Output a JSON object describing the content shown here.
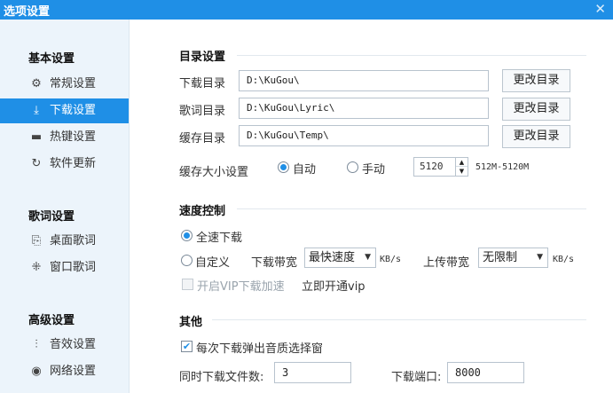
{
  "window": {
    "title": "选项设置",
    "close_glyph": "✕"
  },
  "sidebar": {
    "groups": [
      {
        "label": "基本设置"
      },
      {
        "label": "歌词设置"
      },
      {
        "label": "高级设置"
      }
    ],
    "items": [
      {
        "label": "常规设置",
        "icon": "gear-icon",
        "glyph": "⚙"
      },
      {
        "label": "下载设置",
        "icon": "download-icon",
        "glyph": "⤓",
        "active": true
      },
      {
        "label": "热键设置",
        "icon": "keyboard-icon",
        "glyph": "▬"
      },
      {
        "label": "软件更新",
        "icon": "update-icon",
        "glyph": "↻"
      },
      {
        "label": "桌面歌词",
        "icon": "desktop-lyric-icon",
        "glyph": "⎘"
      },
      {
        "label": "窗口歌词",
        "icon": "window-lyric-icon",
        "glyph": "⁜"
      },
      {
        "label": "音效设置",
        "icon": "equalizer-icon",
        "glyph": "⫶"
      },
      {
        "label": "网络设置",
        "icon": "network-icon",
        "glyph": "◉"
      }
    ],
    "accent": "#1f8fe6"
  },
  "dir": {
    "section_title": "目录设置",
    "download": {
      "label": "下载目录",
      "value": "D:\\KuGou\\",
      "button": "更改目录"
    },
    "lyric": {
      "label": "歌词目录",
      "value": "D:\\KuGou\\Lyric\\",
      "button": "更改目录"
    },
    "cache": {
      "label": "缓存目录",
      "value": "D:\\KuGou\\Temp\\",
      "button": "更改目录"
    },
    "cache_size": {
      "label": "缓存大小设置",
      "auto": "自动",
      "manual": "手动",
      "selected": "auto",
      "value": "5120",
      "range_hint": "512M-5120M"
    }
  },
  "speed": {
    "section_title": "速度控制",
    "full": "全速下载",
    "custom": "自定义",
    "selected": "full",
    "download_bw_label": "下载带宽",
    "download_bw_value": "最快速度",
    "upload_bw_label": "上传带宽",
    "upload_bw_value": "无限制",
    "unit": "KB/s",
    "vip_accel": "开启VIP下载加速",
    "vip_accel_checked": false,
    "vip_link": "立即开通vip"
  },
  "other": {
    "section_title": "其他",
    "quality_popup": "每次下载弹出音质选择窗",
    "quality_popup_checked": true,
    "concurrent_label": "同时下载文件数:",
    "concurrent_value": "3",
    "port_label": "下载端口:",
    "port_value": "8000"
  }
}
